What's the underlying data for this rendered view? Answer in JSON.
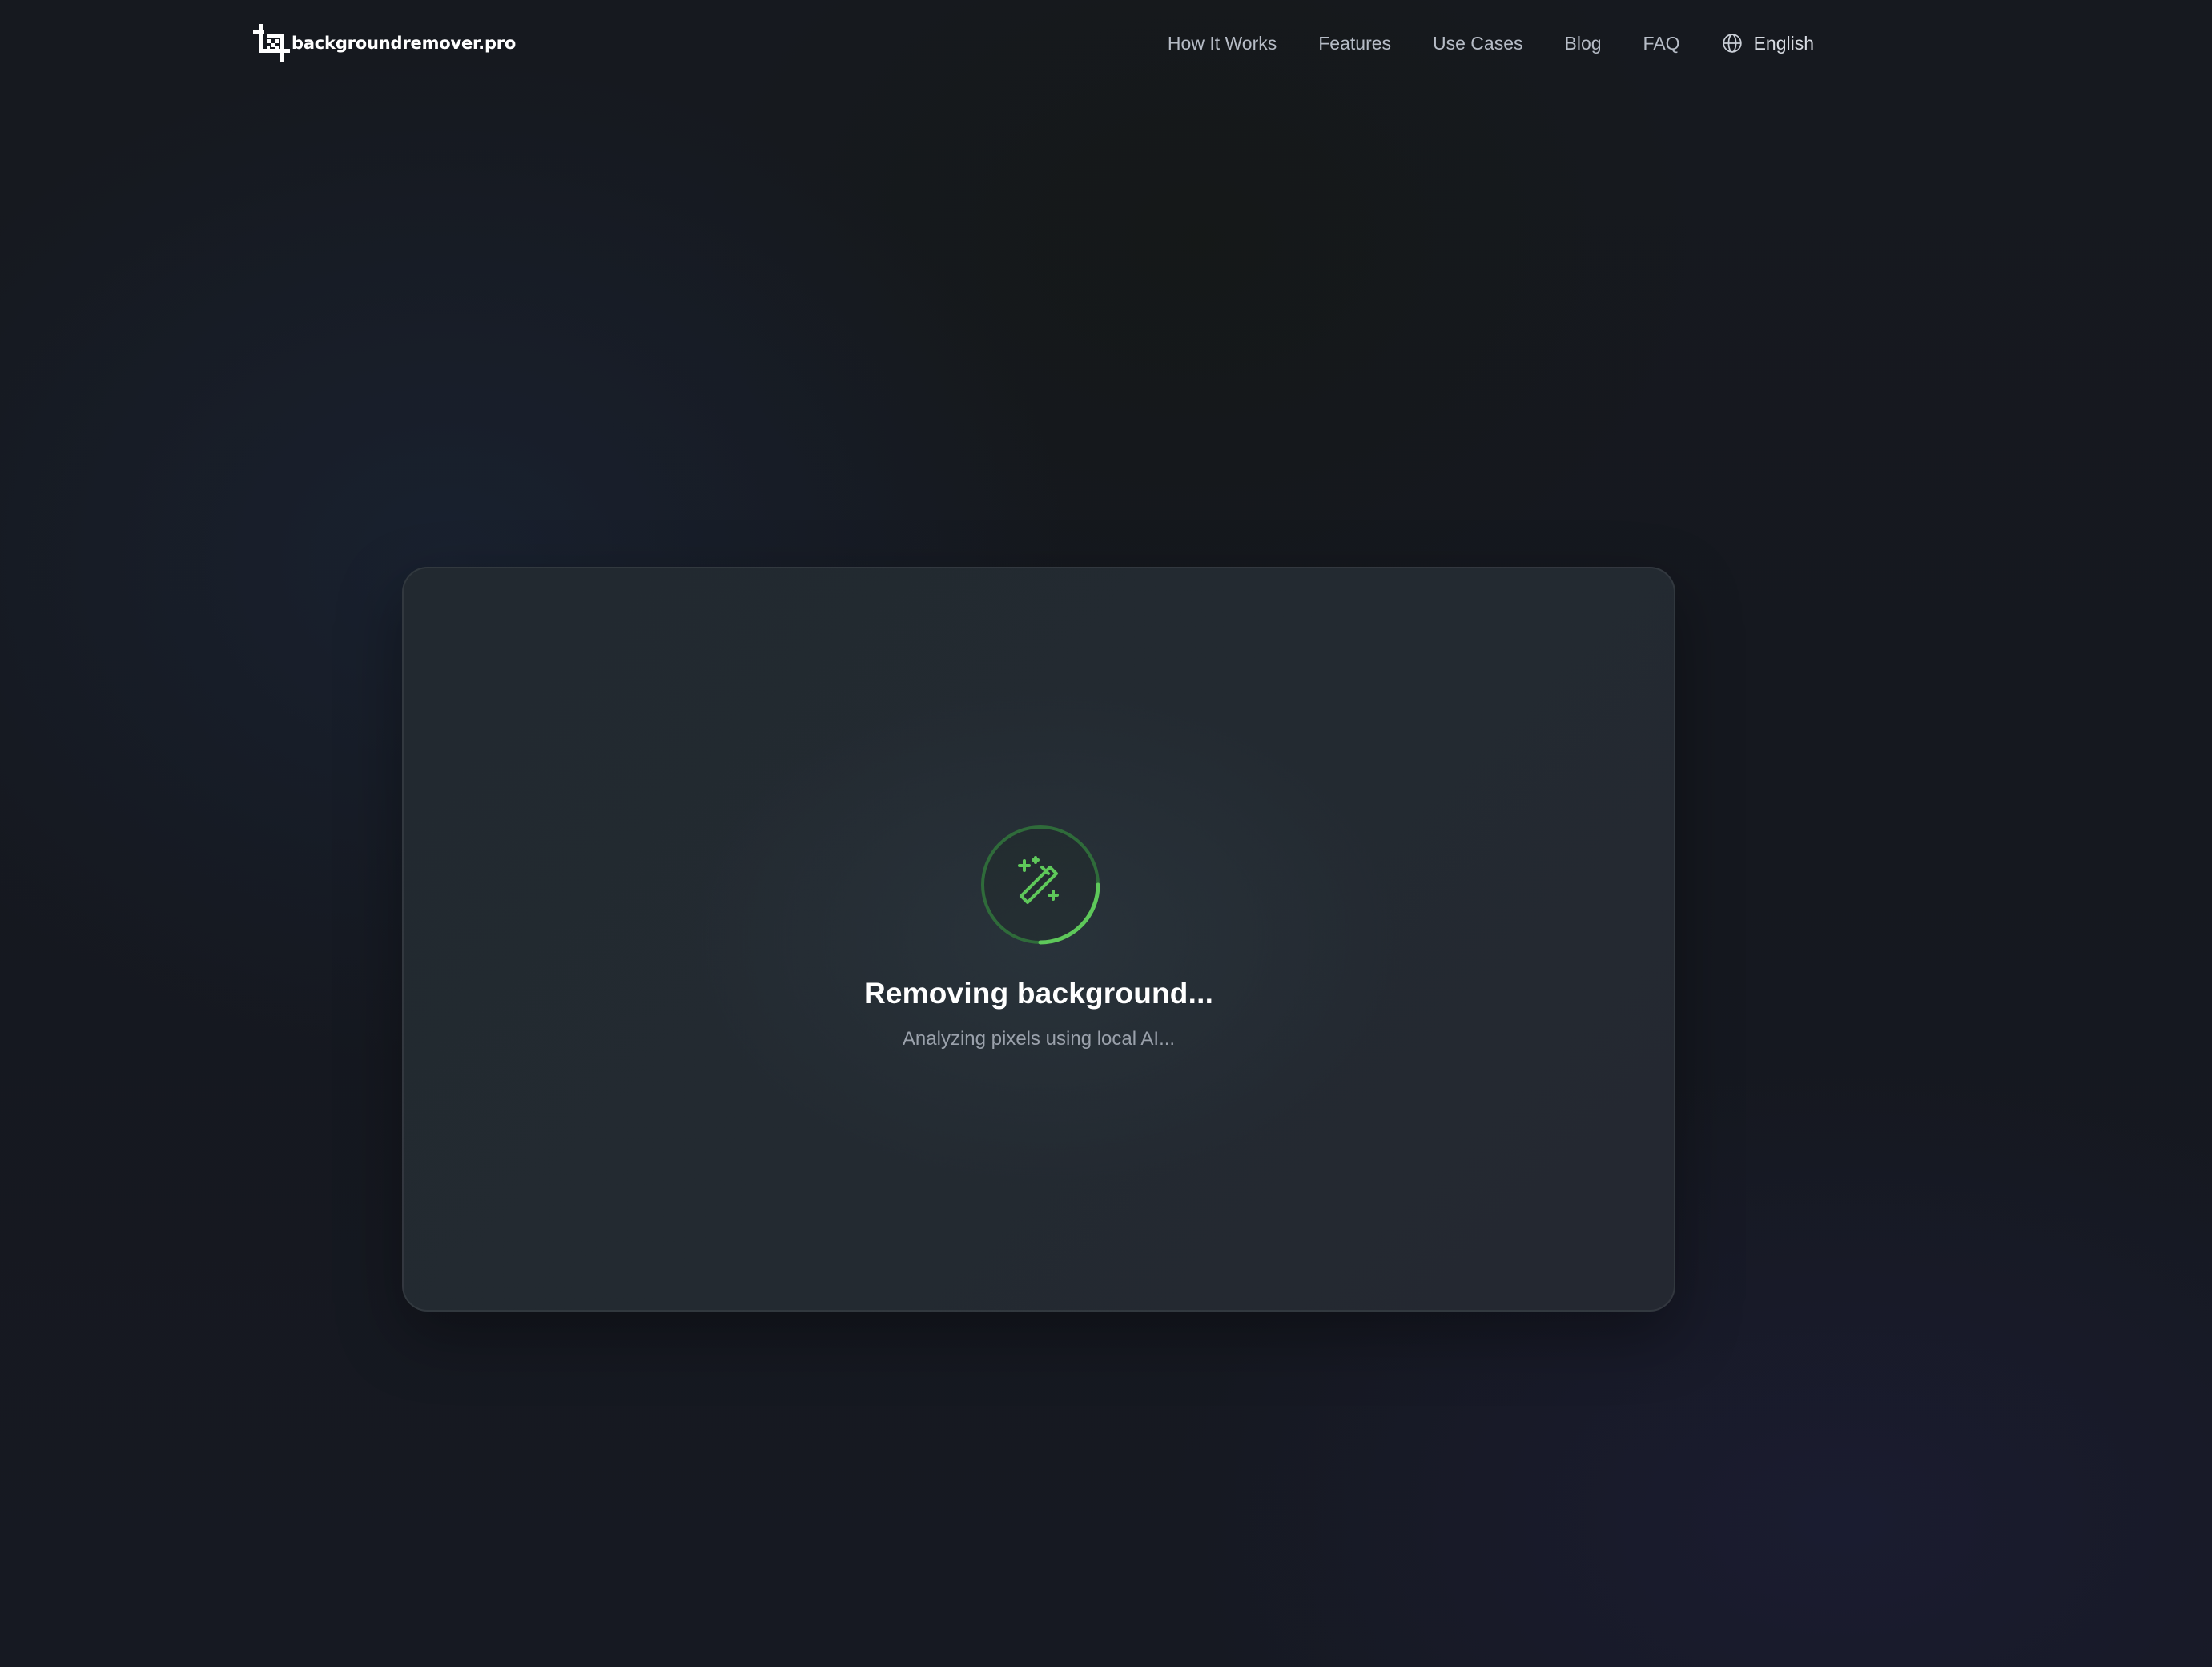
{
  "header": {
    "logo_text": "backgroundremover.pro",
    "logo_icon": "crop-icon",
    "nav": {
      "how_it_works": "How It Works",
      "features": "Features",
      "use_cases": "Use Cases",
      "blog": "Blog",
      "faq": "FAQ"
    },
    "language": {
      "icon": "globe-icon",
      "label": "English"
    }
  },
  "processing": {
    "icon": "magic-wand-icon",
    "title": "Removing background...",
    "subtitle": "Analyzing pixels using local AI...",
    "accent_color": "#5ec85a",
    "track_color": "#2f6b3a"
  }
}
